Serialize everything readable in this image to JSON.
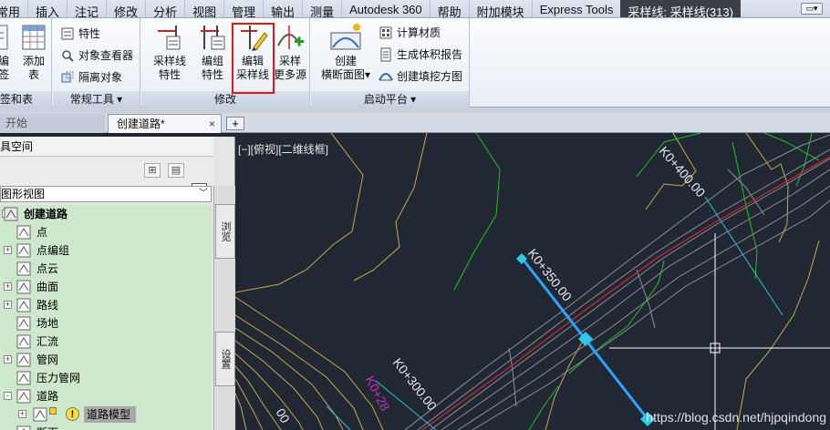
{
  "ribbon": {
    "tabs": [
      "常用",
      "插入",
      "注记",
      "修改",
      "分析",
      "视图",
      "管理",
      "输出",
      "测量",
      "Autodesk 360",
      "帮助",
      "附加模块",
      "Express Tools",
      "采样线: 采样线(313)"
    ],
    "active_tab": "采样线: 采样线(313)",
    "minimize_symbol": "▭▾",
    "panels": {
      "labels_tables": {
        "title": "标签和表",
        "buttons": [
          {
            "label_line1": "编",
            "label_line2": "签"
          },
          {
            "label_line1": "添加",
            "label_line2": "表"
          }
        ]
      },
      "general_tools": {
        "title": "常规工具",
        "buttons": [
          "特性",
          "对象查看器",
          "隔离对象"
        ]
      },
      "modify": {
        "title": "修改",
        "buttons": [
          {
            "label_line1": "采样线",
            "label_line2": "特性"
          },
          {
            "label_line1": "编组",
            "label_line2": "特性"
          },
          {
            "label_line1": "编辑",
            "label_line2": "采样线"
          },
          {
            "label_line1": "采样",
            "label_line2": "更多源"
          }
        ]
      },
      "launch_pad": {
        "title": "启动平台",
        "big_button": {
          "label_line1": "创建",
          "label_line2": "横断面图"
        },
        "buttons": [
          "计算材质",
          "生成体积报告",
          "创建填挖方图"
        ]
      }
    }
  },
  "document_tabs": [
    {
      "label": "开始",
      "active": false
    },
    {
      "label": "创建道路*",
      "active": true
    }
  ],
  "tab_close_symbol": "×",
  "tab_add_symbol": "+",
  "toolspace": {
    "title": "具空间",
    "view_select": "图形视图",
    "help_symbol": "?",
    "side_tabs": [
      "浏览",
      "设置"
    ],
    "tree": [
      {
        "label": "创建道路",
        "level": 0,
        "expander": "-",
        "icon": "drawing-icon"
      },
      {
        "label": "点",
        "level": 1,
        "expander": "",
        "icon": "point-icon"
      },
      {
        "label": "点编组",
        "level": 1,
        "expander": "+",
        "icon": "point-group-icon"
      },
      {
        "label": "点云",
        "level": 1,
        "expander": "",
        "icon": "point-cloud-icon"
      },
      {
        "label": "曲面",
        "level": 1,
        "expander": "+",
        "icon": "surface-icon"
      },
      {
        "label": "路线",
        "level": 1,
        "expander": "+",
        "icon": "alignment-icon"
      },
      {
        "label": "场地",
        "level": 1,
        "expander": "",
        "icon": "site-icon"
      },
      {
        "label": "汇流",
        "level": 1,
        "expander": "",
        "icon": "catchment-icon"
      },
      {
        "label": "管网",
        "level": 1,
        "expander": "+",
        "icon": "pipe-network-icon"
      },
      {
        "label": "压力管网",
        "level": 1,
        "expander": "",
        "icon": "pressure-network-icon"
      },
      {
        "label": "道路",
        "level": 1,
        "expander": "-",
        "icon": "corridor-icon"
      },
      {
        "label": "道路模型",
        "level": 2,
        "expander": "+",
        "icon": "corridor-model-icon",
        "selected": true,
        "warning": "!"
      },
      {
        "label": "断面",
        "level": 1,
        "expander": "",
        "icon": "assembly-icon"
      }
    ]
  },
  "canvas": {
    "viewport_label": "[−][俯视][二维线框]",
    "station_labels": [
      "K0+400.00",
      "K0+350.00",
      "K0+300.00",
      "00",
      "K0+28"
    ],
    "watermark": "https://blog.csdn.net/hjpqindong",
    "colors": {
      "background": "#212733",
      "contour": "#c8a84a",
      "green_line": "#19c21e",
      "gray_line": "#8d8f96",
      "centerline": "#cc2c2c",
      "cyan_line": "#18c6d6",
      "sample_line": "#2aa6ff",
      "magenta_label": "#c030c0"
    }
  }
}
